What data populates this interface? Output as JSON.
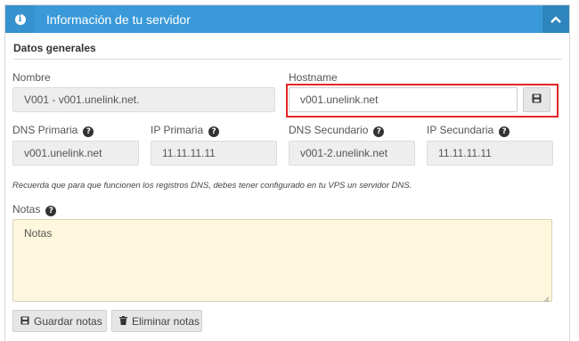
{
  "header": {
    "title": "Información de tu servidor"
  },
  "general": {
    "title": "Datos generales"
  },
  "nombre": {
    "label": "Nombre",
    "value": "V001 - v001.unelink.net."
  },
  "hostname": {
    "label": "Hostname",
    "value": "v001.unelink.net"
  },
  "dns_primaria": {
    "label": "DNS Primaria",
    "value": "v001.unelink.net"
  },
  "ip_primaria": {
    "label": "IP Primaria",
    "value": "11.11.11.11"
  },
  "dns_secundario": {
    "label": "DNS Secundario",
    "value": "v001-2.unelink.net"
  },
  "ip_secundaria": {
    "label": "IP Secundaria",
    "value": "11.11.11.11"
  },
  "hint": "Recuerda que para que funcionen los registros DNS, debes tener configurado en tu VPS un servidor DNS.",
  "notas": {
    "label": "Notas",
    "placeholder": "Notas"
  },
  "buttons": {
    "save_notes": "Guardar notas",
    "delete_notes": "Eliminar notas"
  },
  "icons": {
    "info": "info-icon",
    "collapse": "chevron-up-icon",
    "help": "question-circle-icon",
    "save": "floppy-disk-icon",
    "trash": "trash-icon"
  },
  "colors": {
    "header": "#3a9ad9",
    "highlight": "#e32626",
    "notes_bg": "#fdf7dd"
  }
}
